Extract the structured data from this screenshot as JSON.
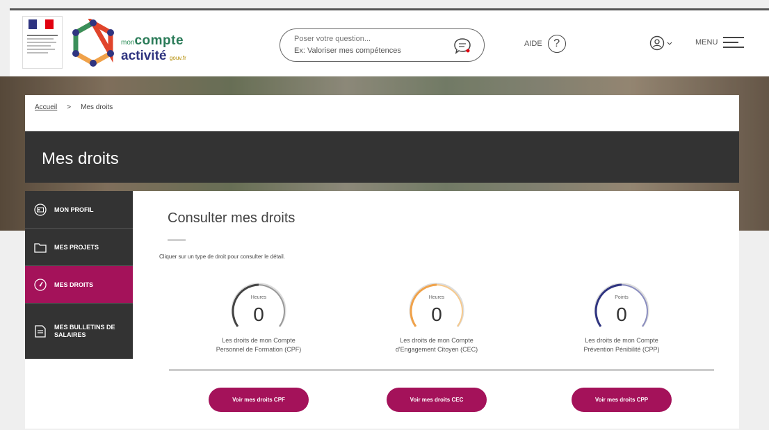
{
  "header": {
    "logo": {
      "mon": "mon",
      "compte": "compte",
      "activite": "activité",
      "gouv": "gouv.fr"
    },
    "search": {
      "placeholder": "Poser votre question...",
      "example": "Ex: Valoriser mes compétences"
    },
    "help_label": "AIDE",
    "help_symbol": "?",
    "menu_label": "MENU"
  },
  "breadcrumb": {
    "home": "Accueil",
    "separator": ">",
    "current": "Mes droits"
  },
  "page_title": "Mes droits",
  "sidebar": {
    "items": [
      {
        "label": "MON PROFIL",
        "icon": "profile-card-icon",
        "active": false
      },
      {
        "label": "MES PROJETS",
        "icon": "folder-icon",
        "active": false
      },
      {
        "label": "MES DROITS",
        "icon": "gauge-icon",
        "active": true
      },
      {
        "label": "MES BULLETINS DE SALAIRES",
        "icon": "document-icon",
        "active": false
      }
    ]
  },
  "main": {
    "title": "Consulter mes droits",
    "hint": "Cliquer sur un type de droit pour consulter le détail.",
    "rights": [
      {
        "unit": "Heures",
        "value": "0",
        "label1": "Les droits de mon Compte",
        "label2": "Personnel de Formation (CPF)",
        "color": "#888888",
        "button": "Voir mes droits CPF"
      },
      {
        "unit": "Heures",
        "value": "0",
        "label1": "Les droits de mon Compte",
        "label2": "d'Engagement Citoyen (CEC)",
        "color": "#f0a24a",
        "button": "Voir mes droits CEC"
      },
      {
        "unit": "Points",
        "value": "0",
        "label1": "Les droits de mon Compte",
        "label2": "Prévention Pénibilité (CPP)",
        "color": "#2f3480",
        "button": "Voir mes droits CPP"
      }
    ]
  },
  "colors": {
    "accent": "#a4125a",
    "dark": "#333333"
  }
}
